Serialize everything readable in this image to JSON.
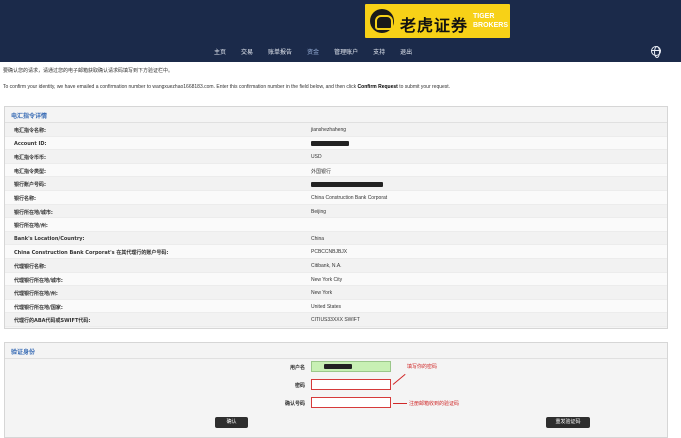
{
  "header": {
    "logo_cn": "老虎证券",
    "logo_en_line1": "TIGER",
    "logo_en_line2": "BROKERS",
    "nav": [
      "主页",
      "交易",
      "账单报告",
      "资金",
      "管理账户",
      "支持",
      "退出"
    ],
    "active_nav_index": 3,
    "colors": {
      "header_bg": "#1b2a4a",
      "logo_bg": "#f7d117",
      "accent": "#3d6fb6",
      "error": "#d02828"
    }
  },
  "intro": {
    "cn": "要确认您的请求，请通过您的电子邮箱获取确认请求码填写到下方验证栏中。",
    "en_prefix": "To confirm your identity, we have emailed a confirmation number to wangxuezhao1668183.com. Enter this confirmation number in the field below, and then click ",
    "en_bold": "Confirm Request",
    "en_suffix": " to submit your request."
  },
  "details": {
    "title": "电汇指令详情",
    "rows": [
      {
        "label": "电汇指令名称:",
        "value": "jianshezhaheng"
      },
      {
        "label": "Account ID:",
        "value": "",
        "redacted": true,
        "redact_len": 38
      },
      {
        "label": "电汇指令币币:",
        "value": "USD"
      },
      {
        "label": "电汇指令类型:",
        "value": "外国银行"
      },
      {
        "label": "银行账户号码:",
        "value": "",
        "redacted": true,
        "redact_len": 72
      },
      {
        "label": "银行名称:",
        "value": "China Construction Bank Corporat"
      },
      {
        "label": "银行所在地/城市:",
        "value": "Beijing"
      },
      {
        "label": "银行所在地/州:",
        "value": ""
      },
      {
        "label": "Bank's Location/Country:",
        "value": "China"
      },
      {
        "label": "China Construction Bank Corporat's 在其代理行的账户号码:",
        "value": "PCBCCNBJBJX"
      },
      {
        "label": "代理银行名称:",
        "value": "Citibank, N.A."
      },
      {
        "label": "代理银行所在地/城市:",
        "value": "New York City"
      },
      {
        "label": "代理银行所在地/州:",
        "value": "New York"
      },
      {
        "label": "代理银行所在地/国家:",
        "value": "United States"
      },
      {
        "label": "代理行的ABA代码或SWIFT代码:",
        "value": "CITIUS33XXX SWIFT"
      }
    ]
  },
  "verify": {
    "title": "验证身份",
    "username_label": "用户名",
    "username_value": "",
    "password_label": "密码",
    "password_value": "",
    "confirm_code_label": "确认号码",
    "confirm_code_value": "",
    "note_password": "填写你的密码",
    "note_code": "注册邮箱收到的验证码",
    "confirm_button": "确认",
    "resend_button": "重发验证码"
  }
}
